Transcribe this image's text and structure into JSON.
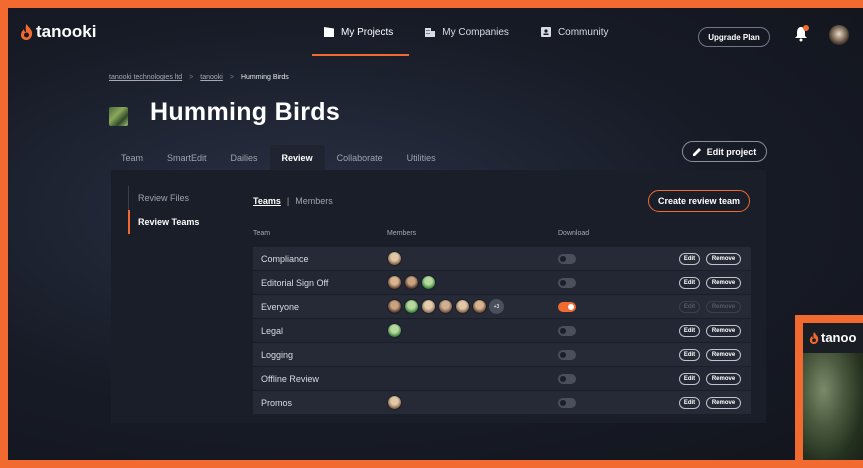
{
  "app": {
    "logo_text": "tanooki",
    "brand_color": "#f26a30"
  },
  "nav": {
    "items": [
      {
        "label": "My Projects",
        "icon": "clapperboard-icon",
        "active": true
      },
      {
        "label": "My Companies",
        "icon": "building-icon",
        "active": false
      },
      {
        "label": "Community",
        "icon": "contact-card-icon",
        "active": false
      }
    ],
    "upgrade_label": "Upgrade Plan"
  },
  "breadcrumb": {
    "items": [
      "tanooki technologies ltd",
      "tanooki",
      "Humming Birds"
    ],
    "separator": ">"
  },
  "project": {
    "title": "Humming Birds",
    "edit_label": "Edit project"
  },
  "tabs": [
    "Team",
    "SmartEdit",
    "Dailies",
    "Review",
    "Collaborate",
    "Utilities"
  ],
  "active_tab": "Review",
  "sidebar": {
    "items": [
      "Review Files",
      "Review Teams"
    ],
    "active": "Review Teams"
  },
  "subtabs": {
    "teams": "Teams",
    "divider": "|",
    "members": "Members"
  },
  "create_label": "Create review team",
  "table": {
    "headers": {
      "team": "Team",
      "members": "Members",
      "download": "Download"
    },
    "edit_label": "Edit",
    "remove_label": "Remove",
    "rows": [
      {
        "team": "Compliance",
        "members": 1,
        "extra": "",
        "download": false,
        "disabled": false
      },
      {
        "team": "Editorial Sign Off",
        "members": 3,
        "extra": "",
        "download": false,
        "disabled": false
      },
      {
        "team": "Everyone",
        "members": 6,
        "extra": "+3",
        "download": true,
        "disabled": true
      },
      {
        "team": "Legal",
        "members": 1,
        "extra": "",
        "download": false,
        "disabled": false
      },
      {
        "team": "Logging",
        "members": 0,
        "extra": "",
        "download": false,
        "disabled": false
      },
      {
        "team": "Offline Review",
        "members": 0,
        "extra": "",
        "download": false,
        "disabled": false
      },
      {
        "team": "Promos",
        "members": 1,
        "extra": "",
        "download": false,
        "disabled": false
      }
    ]
  },
  "preview": {
    "logo_text": "tanoo"
  }
}
